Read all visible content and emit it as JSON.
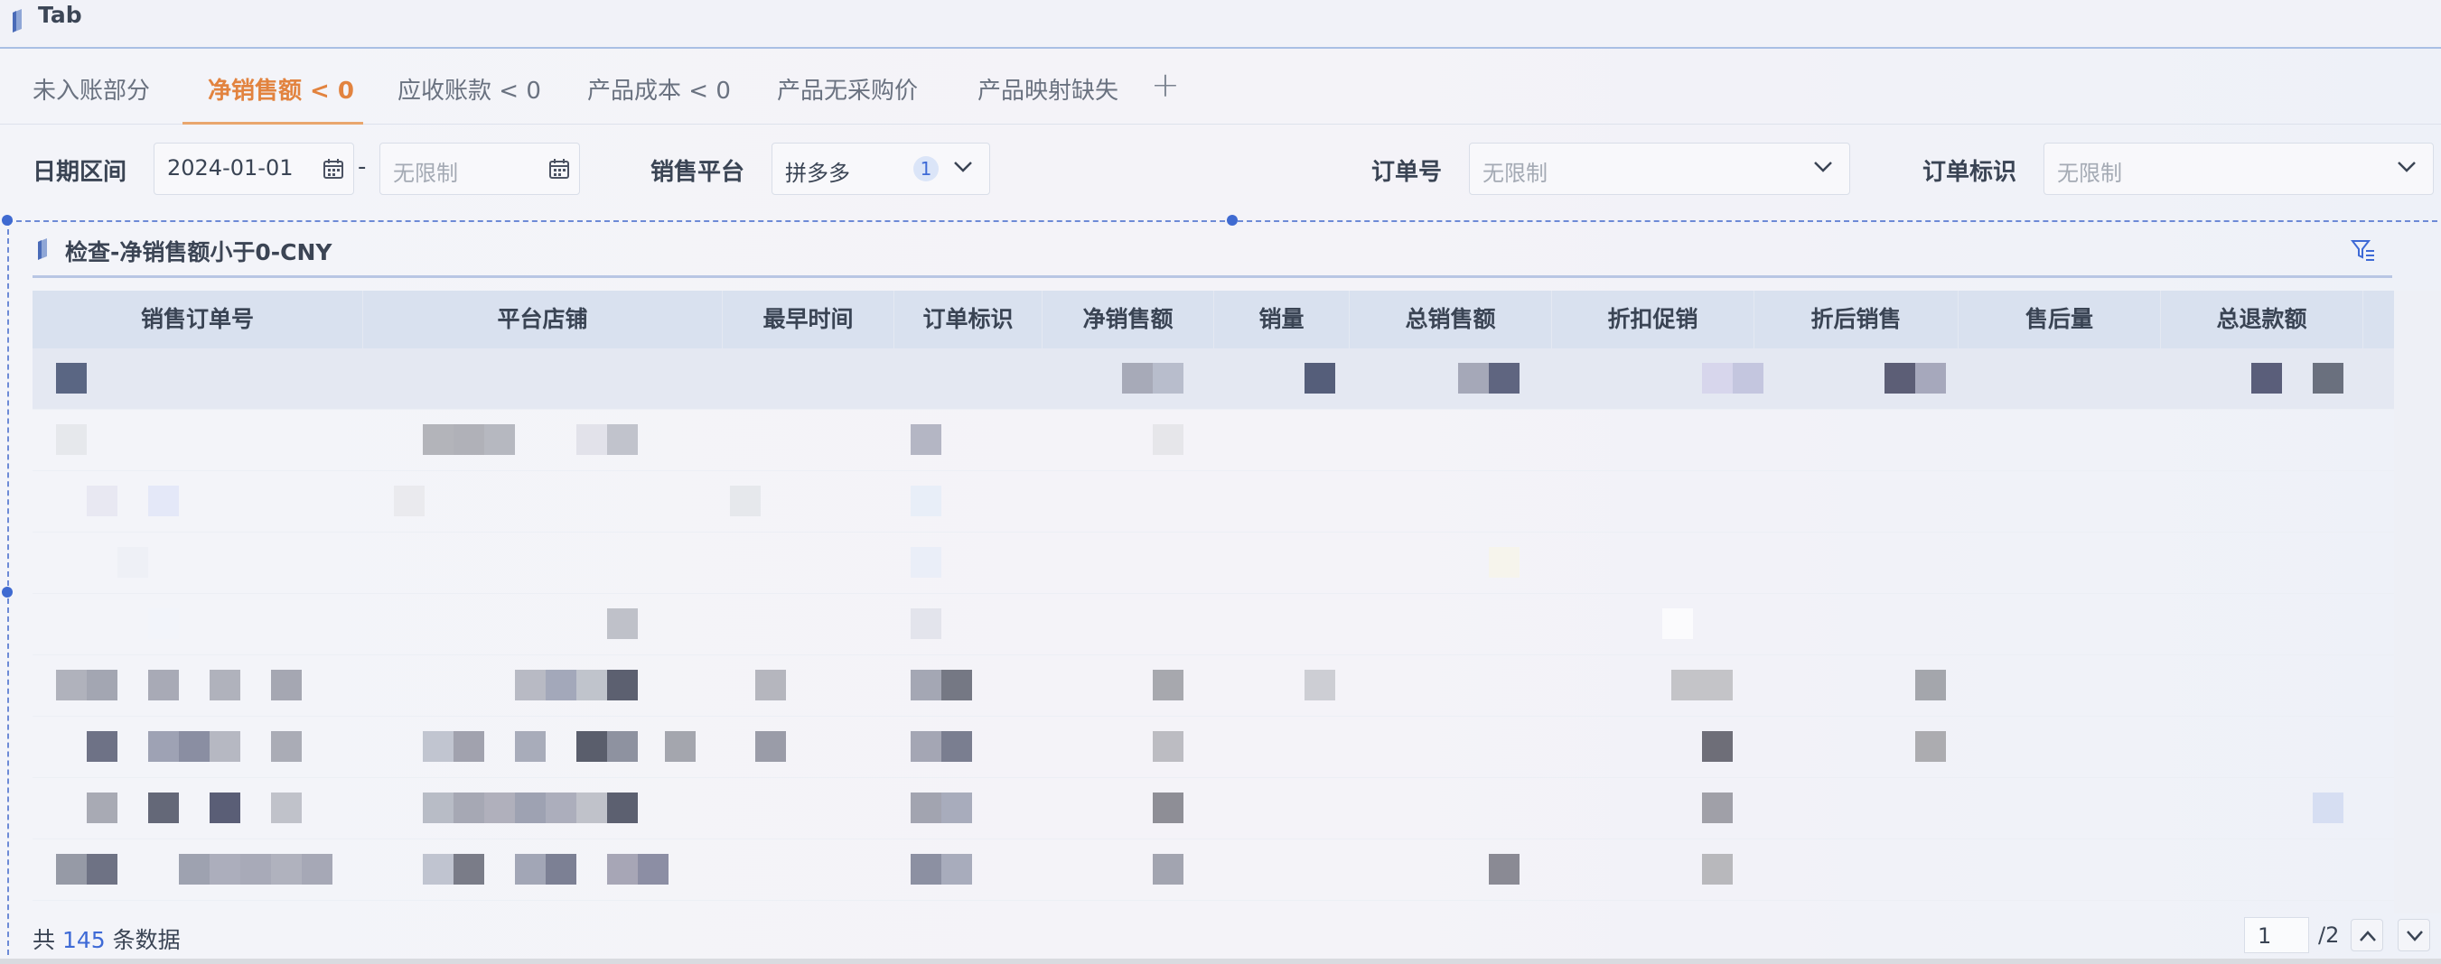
{
  "header": {
    "title": "Tab"
  },
  "tabs": [
    {
      "label": "未入账部分",
      "active": false
    },
    {
      "label": "净销售额 < 0",
      "active": true
    },
    {
      "label": "应收账款 < 0",
      "active": false
    },
    {
      "label": "产品成本 < 0",
      "active": false
    },
    {
      "label": "产品无采购价",
      "active": false
    },
    {
      "label": "产品映射缺失",
      "active": false
    }
  ],
  "add_tab_icon": "plus-icon",
  "filters": {
    "date_label": "日期区间",
    "date_start": "2024-01-01",
    "date_separator": "-",
    "date_end_placeholder": "无限制",
    "platform_label": "销售平台",
    "platform_value": "拼多多",
    "platform_count": "1",
    "order_no_label": "订单号",
    "order_no_placeholder": "无限制",
    "order_tag_label": "订单标识",
    "order_tag_placeholder": "无限制"
  },
  "section": {
    "title": "检查-净销售额小于0-CNY",
    "filter_icon": "filter-icon"
  },
  "table": {
    "columns": [
      "销售订单号",
      "平台店铺",
      "最早时间",
      "订单标识",
      "净销售额",
      "销量",
      "总销售额",
      "折扣促销",
      "折后销售",
      "售后量",
      "总退款额"
    ],
    "row_count_visible": 9,
    "cells_note": ""
  },
  "footer": {
    "count_prefix": "共",
    "count_value": "145",
    "count_suffix": "条数据",
    "page_current": "1",
    "page_total": "/2"
  },
  "colors": {
    "accent_orange": "#e2833f",
    "accent_blue": "#3e6ad6",
    "header_bg": "#d9e1ef"
  }
}
